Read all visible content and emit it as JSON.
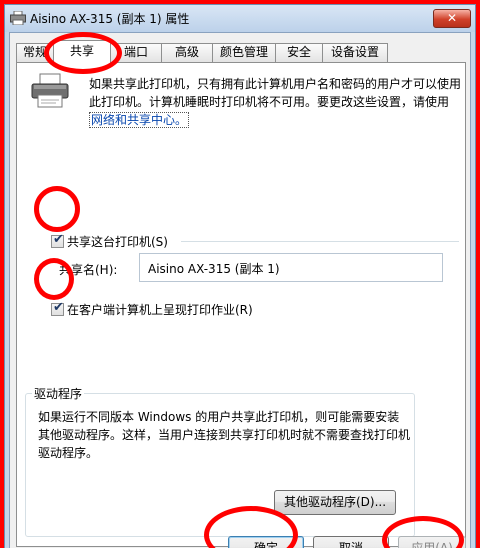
{
  "window": {
    "title": "Aisino AX-315 (副本 1) 属性",
    "close_glyph": "✕"
  },
  "tabs": [
    {
      "label": "常规"
    },
    {
      "label": "共享",
      "active": true
    },
    {
      "label": "端口"
    },
    {
      "label": "高级"
    },
    {
      "label": "颜色管理"
    },
    {
      "label": "安全"
    },
    {
      "label": "设备设置"
    }
  ],
  "sharing": {
    "description_text": "如果共享此打印机，只有拥有此计算机用户名和密码的用户才可以使用此打印机。计算机睡眠时打印机将不可用。要更改这些设置，请使用",
    "description_link": "网络和共享中心。",
    "share_checkbox_label": "共享这台打印机(S)",
    "share_checked": true,
    "share_name_label": "共享名(H):",
    "share_name_value": "Aisino AX-315 (副本 1)",
    "render_checkbox_label": "在客户端计算机上呈现打印作业(R)",
    "render_checked": true
  },
  "drivers": {
    "title": "驱动程序",
    "description": "如果运行不同版本 Windows 的用户共享此打印机，则可能需要安装其他驱动程序。这样，当用户连接到共享打印机时就不需要查找打印机驱动程序。",
    "other_drivers_button": "其他驱动程序(D)..."
  },
  "footer": {
    "ok_label": "确定",
    "cancel_label": "取消",
    "apply_label": "应用(A)"
  },
  "colors": {
    "annotation_red": "#ff0000",
    "link": "#0645ad"
  },
  "icons": {
    "title": "printer-icon",
    "tab_panel": "printer-icon",
    "check": "checkmark-icon",
    "close": "close-icon"
  }
}
